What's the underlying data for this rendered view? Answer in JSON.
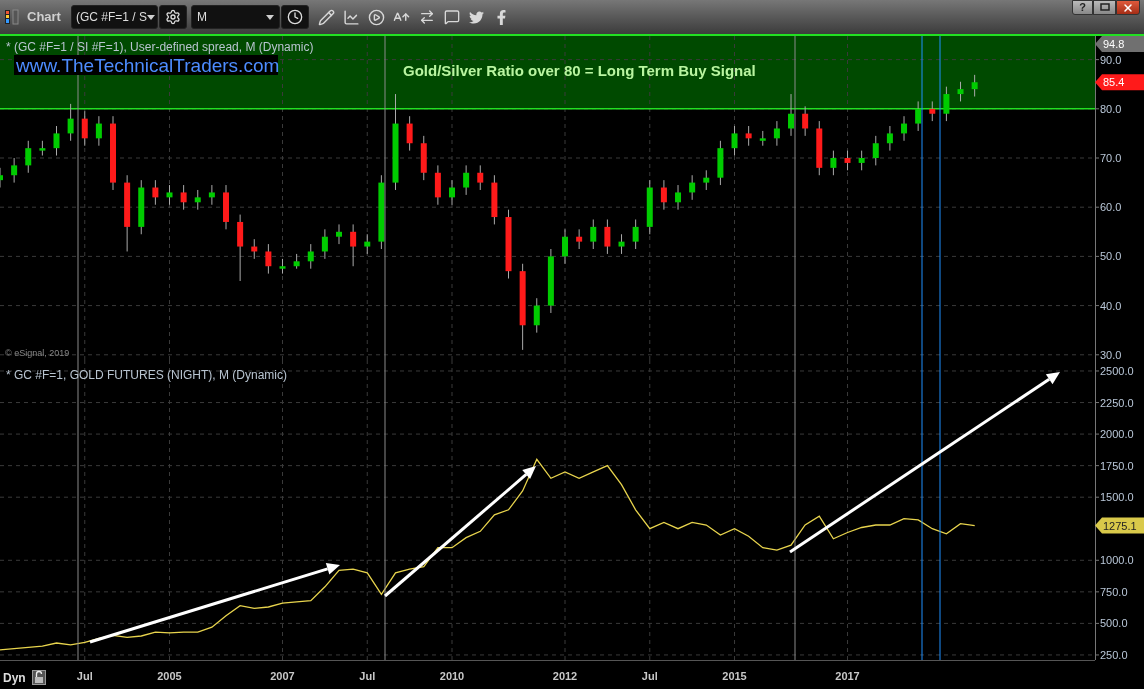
{
  "window": {
    "title": "Chart",
    "help": "?"
  },
  "toolbar": {
    "symbol": {
      "value": "(GC #F=1 / S"
    },
    "interval": {
      "value": "M"
    }
  },
  "panels": [
    {
      "legend": "* (GC #F=1 / SI #F=1), User-defined spread, M (Dynamic)",
      "link": "www.TheTechnicalTraders.com",
      "copyright": "© eSignal, 2019",
      "price_labels": [
        {
          "text": "94.8",
          "kind": "high"
        },
        {
          "text": "85.4",
          "kind": "last"
        }
      ],
      "chart_data": {
        "type": "candlestick",
        "grid": true,
        "xlim": [
          2002,
          2021.38
        ],
        "ylim": [
          28.94,
          94.8
        ],
        "yticks": [
          {
            "value": 30,
            "label": "30.0"
          },
          {
            "value": 40,
            "label": "40.0"
          },
          {
            "value": 50,
            "label": "50.0"
          },
          {
            "value": 60,
            "label": "60.0"
          },
          {
            "value": 70,
            "label": "70.0"
          },
          {
            "value": 80,
            "label": "80.0"
          },
          {
            "value": 90,
            "label": "90.0"
          }
        ],
        "x": [
          2002,
          2002.25,
          2002.5,
          2002.75,
          2003,
          2003.25,
          2003.5,
          2003.75,
          2004,
          2004.25,
          2004.5,
          2004.75,
          2005,
          2005.25,
          2005.5,
          2005.75,
          2006,
          2006.25,
          2006.5,
          2006.75,
          2007,
          2007.25,
          2007.5,
          2007.75,
          2008,
          2008.25,
          2008.5,
          2008.75,
          2009,
          2009.25,
          2009.5,
          2009.75,
          2010,
          2010.25,
          2010.5,
          2010.75,
          2011,
          2011.25,
          2011.5,
          2011.75,
          2012,
          2012.25,
          2012.5,
          2012.75,
          2013,
          2013.25,
          2013.5,
          2013.75,
          2014,
          2014.25,
          2014.5,
          2014.75,
          2015,
          2015.25,
          2015.5,
          2015.75,
          2016,
          2016.25,
          2016.5,
          2016.75,
          2017,
          2017.25,
          2017.5,
          2017.75,
          2018,
          2018.25,
          2018.5,
          2018.75,
          2019,
          2019.25
        ],
        "ohlc": [
          [
            65.5,
            68,
            64,
            66.5
          ],
          [
            66.5,
            70,
            65,
            68.5
          ],
          [
            68.5,
            73.5,
            67,
            72
          ],
          [
            71.5,
            73.5,
            70.5,
            72
          ],
          [
            72,
            76.5,
            70.5,
            75
          ],
          [
            75,
            81,
            73.5,
            78
          ],
          [
            78,
            79.5,
            72.5,
            74
          ],
          [
            74,
            78.5,
            72.5,
            77
          ],
          [
            77,
            78.5,
            63.5,
            65
          ],
          [
            65,
            66.5,
            51,
            56
          ],
          [
            56,
            65.5,
            54.5,
            64
          ],
          [
            64,
            65.5,
            60.5,
            62
          ],
          [
            62,
            64.5,
            60.5,
            63
          ],
          [
            63,
            64.5,
            59.5,
            61
          ],
          [
            61,
            63.5,
            59.5,
            62
          ],
          [
            62,
            64.5,
            60.5,
            63
          ],
          [
            63,
            64.5,
            55.5,
            57
          ],
          [
            57,
            58.5,
            45,
            52
          ],
          [
            52,
            53.5,
            49.5,
            51
          ],
          [
            51,
            52.5,
            46.5,
            48
          ],
          [
            47.5,
            49.5,
            46.5,
            48
          ],
          [
            48,
            50.5,
            47.5,
            49
          ],
          [
            49,
            52.5,
            47.5,
            51
          ],
          [
            51,
            55.5,
            49.5,
            54
          ],
          [
            54,
            56.5,
            52.5,
            55
          ],
          [
            55,
            56.5,
            48,
            52
          ],
          [
            52,
            54.5,
            50.5,
            53
          ],
          [
            53,
            66.5,
            51.5,
            65
          ],
          [
            65,
            83,
            63.5,
            77
          ],
          [
            77,
            78.5,
            71.5,
            73
          ],
          [
            73,
            74.5,
            65.5,
            67
          ],
          [
            67,
            68.5,
            60.5,
            62
          ],
          [
            62,
            65.5,
            60.5,
            64
          ],
          [
            64,
            68.5,
            62.5,
            67
          ],
          [
            67,
            68.5,
            63.5,
            65
          ],
          [
            65,
            66.5,
            56.5,
            58
          ],
          [
            58,
            59.5,
            45.5,
            47
          ],
          [
            47,
            48.5,
            31,
            36
          ],
          [
            36,
            41.5,
            34.5,
            40
          ],
          [
            40,
            51.5,
            38.5,
            50
          ],
          [
            50,
            55.5,
            48.5,
            54
          ],
          [
            54,
            55.5,
            51.5,
            53
          ],
          [
            53,
            57.5,
            51.5,
            56
          ],
          [
            56,
            57.5,
            50.5,
            52
          ],
          [
            52,
            54.5,
            50.5,
            53
          ],
          [
            53,
            57.5,
            51.5,
            56
          ],
          [
            56,
            65.5,
            54.5,
            64
          ],
          [
            64,
            65.5,
            59.5,
            61
          ],
          [
            61,
            64.5,
            59.5,
            63
          ],
          [
            63,
            66.5,
            61.5,
            65
          ],
          [
            65,
            67.5,
            63.5,
            66
          ],
          [
            66,
            73.5,
            64.5,
            72
          ],
          [
            72,
            76.5,
            70.5,
            75
          ],
          [
            75,
            76.5,
            72.5,
            74
          ],
          [
            73.5,
            75.5,
            72.5,
            74
          ],
          [
            74,
            77.5,
            72.5,
            76
          ],
          [
            76,
            83,
            74.5,
            79
          ],
          [
            79,
            80.5,
            74.5,
            76
          ],
          [
            76,
            77.5,
            66.5,
            68
          ],
          [
            68,
            71.5,
            66.5,
            70
          ],
          [
            70,
            71.5,
            67.5,
            69
          ],
          [
            69,
            71.5,
            67.5,
            70
          ],
          [
            70,
            74.5,
            68.5,
            73
          ],
          [
            73,
            76.5,
            71.5,
            75
          ],
          [
            75,
            78.5,
            73.5,
            77
          ],
          [
            77,
            81.5,
            75.5,
            80
          ],
          [
            80,
            81.5,
            77.5,
            79
          ],
          [
            79,
            84.5,
            77.5,
            83
          ],
          [
            83,
            85.5,
            81.5,
            84
          ],
          [
            84,
            86.9,
            82.5,
            85.4
          ]
        ],
        "bands": [
          {
            "axis": "y",
            "from": 80,
            "to": 94.8,
            "color": "#004a00"
          }
        ],
        "ref_lines": [
          {
            "axis": "y",
            "value": 80,
            "color": "#22e022"
          }
        ],
        "annotations": [
          "Gold/Silver Ratio over 80 = Long Term Buy Signal"
        ]
      }
    },
    {
      "legend": "* GC #F=1, GOLD FUTURES (NIGHT), M (Dynamic)",
      "price_labels": [
        {
          "text": "1275.1",
          "kind": "last"
        }
      ],
      "chart_data": {
        "type": "line",
        "grid": true,
        "xlim": [
          2002,
          2021.38
        ],
        "ylim": [
          210,
          2587
        ],
        "yticks": [
          {
            "value": 250,
            "label": "250.0"
          },
          {
            "value": 500,
            "label": "500.0"
          },
          {
            "value": 750,
            "label": "750.0"
          },
          {
            "value": 1000,
            "label": "1000.0"
          },
          {
            "value": 1500,
            "label": "1500.0"
          },
          {
            "value": 1750,
            "label": "1750.0"
          },
          {
            "value": 2000,
            "label": "2000.0"
          },
          {
            "value": 2250,
            "label": "2250.0"
          },
          {
            "value": 2500,
            "label": "2500.0"
          }
        ],
        "xticks": [
          {
            "value": 2003.5,
            "label": "Jul"
          },
          {
            "value": 2005,
            "label": "2005"
          },
          {
            "value": 2007,
            "label": "2007"
          },
          {
            "value": 2008.5,
            "label": "Jul"
          },
          {
            "value": 2010,
            "label": "2010"
          },
          {
            "value": 2012,
            "label": "2012"
          },
          {
            "value": 2013.5,
            "label": "Jul"
          },
          {
            "value": 2015,
            "label": "2015"
          },
          {
            "value": 2017,
            "label": "2017"
          }
        ],
        "x": [
          2002,
          2002.25,
          2002.5,
          2002.75,
          2003,
          2003.25,
          2003.5,
          2003.75,
          2004,
          2004.25,
          2004.5,
          2004.75,
          2005,
          2005.25,
          2005.5,
          2005.75,
          2006,
          2006.25,
          2006.5,
          2006.75,
          2007,
          2007.25,
          2007.5,
          2007.75,
          2008,
          2008.25,
          2008.5,
          2008.75,
          2009,
          2009.25,
          2009.5,
          2009.75,
          2010,
          2010.25,
          2010.5,
          2010.75,
          2011,
          2011.25,
          2011.5,
          2011.75,
          2012,
          2012.25,
          2012.5,
          2012.75,
          2013,
          2013.25,
          2013.5,
          2013.75,
          2014,
          2014.25,
          2014.5,
          2014.75,
          2015,
          2015.25,
          2015.5,
          2015.75,
          2016,
          2016.25,
          2016.5,
          2016.75,
          2017,
          2017.25,
          2017.5,
          2017.75,
          2018,
          2018.25,
          2018.5,
          2018.75,
          2019,
          2019.25
        ],
        "series": [
          {
            "color": "#e8d44d",
            "values": [
              290,
              300,
              310,
              320,
              345,
              330,
              350,
              380,
              405,
              390,
              400,
              430,
              425,
              430,
              430,
              470,
              560,
              640,
              620,
              630,
              660,
              670,
              680,
              790,
              920,
              930,
              900,
              730,
              900,
              930,
              950,
              1100,
              1100,
              1180,
              1230,
              1360,
              1400,
              1550,
              1800,
              1650,
              1700,
              1650,
              1700,
              1750,
              1600,
              1400,
              1250,
              1300,
              1250,
              1300,
              1280,
              1200,
              1250,
              1190,
              1100,
              1080,
              1120,
              1280,
              1350,
              1170,
              1220,
              1260,
              1280,
              1280,
              1330,
              1320,
              1250,
              1210,
              1290,
              1275
            ]
          }
        ]
      }
    }
  ],
  "x_axis": {
    "mode": "Dyn",
    "locked": false
  }
}
